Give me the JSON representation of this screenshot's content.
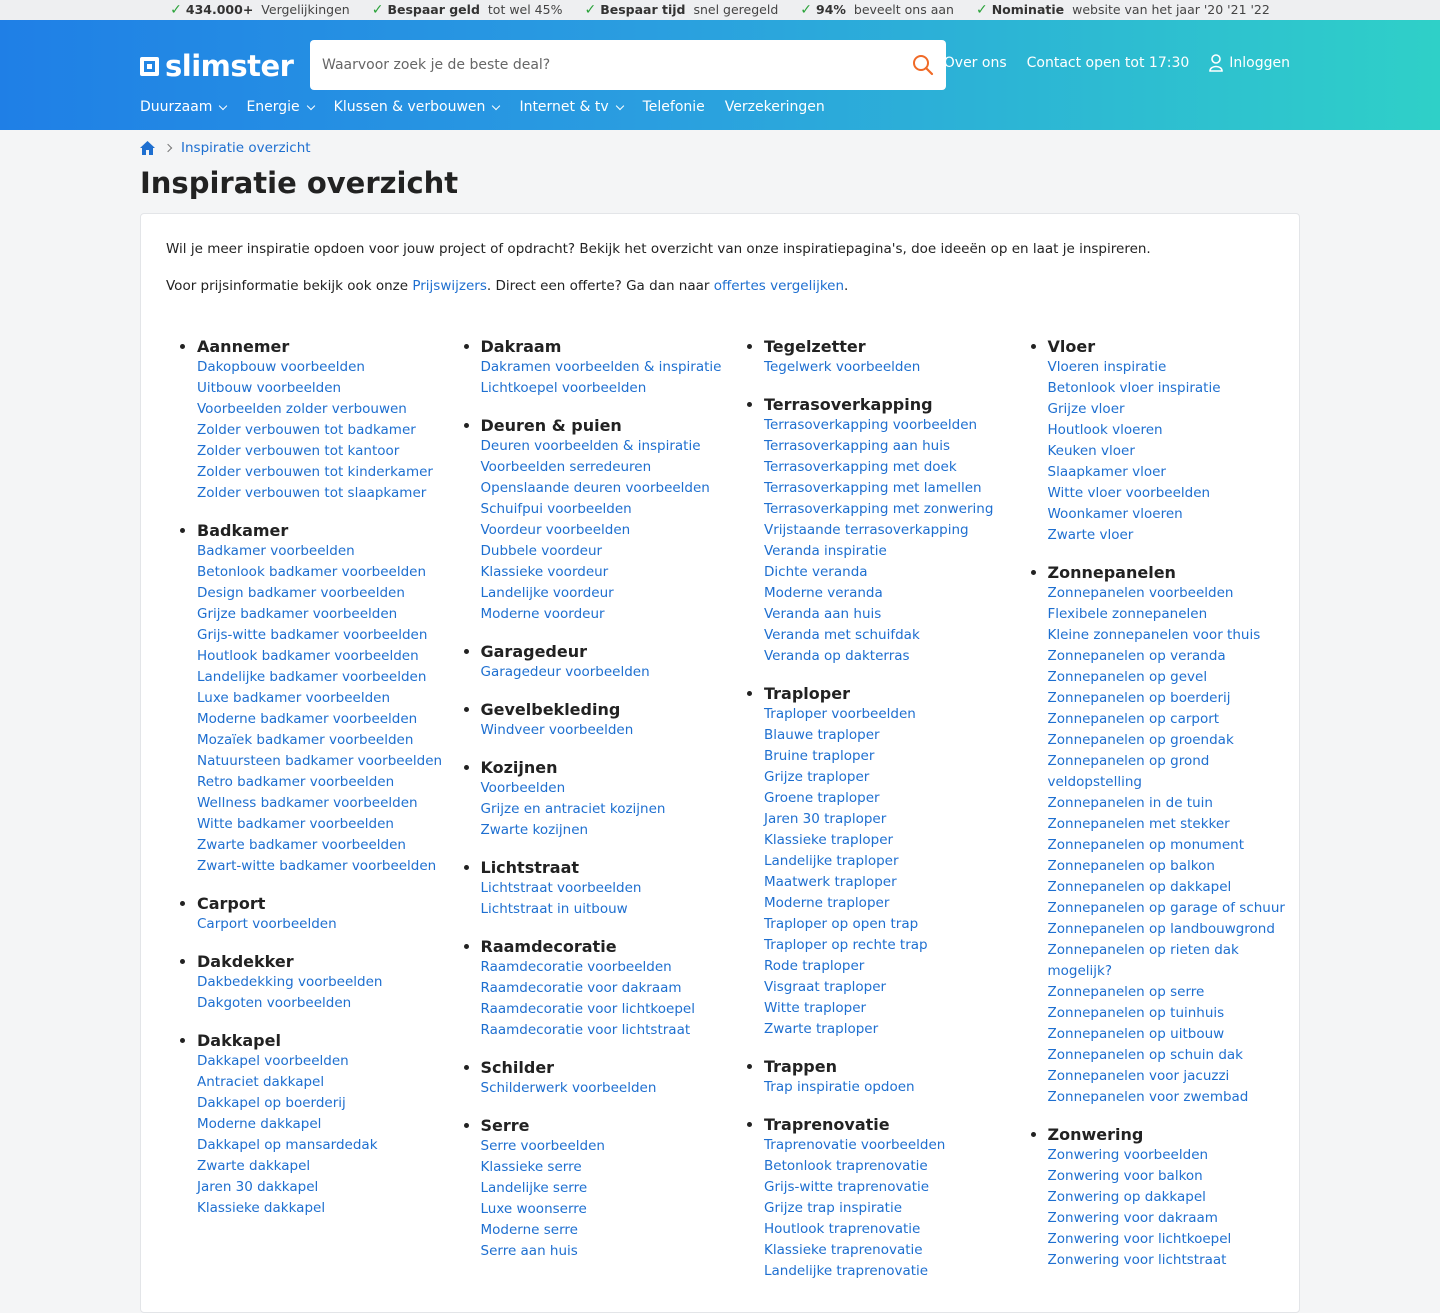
{
  "usp": [
    {
      "bold": "434.000+",
      "text": "Vergelijkingen"
    },
    {
      "bold": "Bespaar geld",
      "text": "tot wel 45%"
    },
    {
      "bold": "Bespaar tijd",
      "text": "snel geregeld"
    },
    {
      "bold": "94%",
      "text": "beveelt ons aan"
    },
    {
      "bold": "Nominatie",
      "text": "website van het jaar '20 '21 '22"
    }
  ],
  "header": {
    "logo": "slimster",
    "search_placeholder": "Waarvoor zoek je de beste deal?",
    "over_ons": "Over ons",
    "contact": "Contact open tot 17:30",
    "login": "Inloggen"
  },
  "nav": [
    {
      "label": "Duurzaam",
      "dropdown": true
    },
    {
      "label": "Energie",
      "dropdown": true
    },
    {
      "label": "Klussen & verbouwen",
      "dropdown": true
    },
    {
      "label": "Internet & tv",
      "dropdown": true
    },
    {
      "label": "Telefonie",
      "dropdown": false
    },
    {
      "label": "Verzekeringen",
      "dropdown": false
    }
  ],
  "breadcrumb": {
    "current": "Inspiratie overzicht"
  },
  "page_title": "Inspiratie overzicht",
  "intro": {
    "p1": "Wil je meer inspiratie opdoen voor jouw project of opdracht? Bekijk het overzicht van onze inspiratiepagina's, doe ideeën op en laat je inspireren.",
    "p2_before": "Voor prijsinformatie bekijk ook onze ",
    "p2_link1": "Prijswijzers",
    "p2_middle": ". Direct een offerte? Ga dan naar ",
    "p2_link2": "offertes vergelijken",
    "p2_after": "."
  },
  "columns": [
    [
      {
        "title": "Aannemer",
        "links": [
          "Dakopbouw voorbeelden",
          "Uitbouw voorbeelden",
          "Voorbeelden zolder verbouwen",
          "Zolder verbouwen tot badkamer",
          "Zolder verbouwen tot kantoor",
          "Zolder verbouwen tot kinderkamer",
          "Zolder verbouwen tot slaapkamer"
        ]
      },
      {
        "title": "Badkamer",
        "links": [
          "Badkamer voorbeelden",
          "Betonlook badkamer voorbeelden",
          "Design badkamer voorbeelden",
          "Grijze badkamer voorbeelden",
          "Grijs-witte badkamer voorbeelden",
          "Houtlook badkamer voorbeelden",
          "Landelijke badkamer voorbeelden",
          "Luxe badkamer voorbeelden",
          "Moderne badkamer voorbeelden",
          "Mozaïek badkamer voorbeelden",
          "Natuursteen badkamer voorbeelden",
          "Retro badkamer voorbeelden",
          "Wellness badkamer voorbeelden",
          "Witte badkamer voorbeelden",
          "Zwarte badkamer voorbeelden",
          "Zwart-witte badkamer voorbeelden"
        ]
      },
      {
        "title": "Carport",
        "links": [
          "Carport voorbeelden"
        ]
      },
      {
        "title": "Dakdekker",
        "links": [
          "Dakbedekking voorbeelden",
          "Dakgoten voorbeelden"
        ]
      },
      {
        "title": "Dakkapel",
        "links": [
          "Dakkapel voorbeelden",
          "Antraciet dakkapel",
          "Dakkapel op boerderij",
          "Moderne dakkapel",
          "Dakkapel op mansardedak",
          "Zwarte dakkapel",
          "Jaren 30 dakkapel",
          "Klassieke dakkapel"
        ]
      }
    ],
    [
      {
        "title": "Dakraam",
        "links": [
          "Dakramen voorbeelden & inspiratie",
          "Lichtkoepel voorbeelden"
        ]
      },
      {
        "title": "Deuren & puien",
        "links": [
          "Deuren voorbeelden & inspiratie",
          "Voorbeelden serredeuren",
          "Openslaande deuren voorbeelden",
          "Schuifpui voorbeelden",
          "Voordeur voorbeelden",
          "Dubbele voordeur",
          "Klassieke voordeur",
          "Landelijke voordeur",
          "Moderne voordeur"
        ]
      },
      {
        "title": "Garagedeur",
        "links": [
          "Garagedeur voorbeelden"
        ]
      },
      {
        "title": "Gevelbekleding",
        "links": [
          "Windveer voorbeelden"
        ]
      },
      {
        "title": "Kozijnen",
        "links": [
          "Voorbeelden",
          "Grijze en antraciet kozijnen",
          "Zwarte kozijnen"
        ]
      },
      {
        "title": "Lichtstraat",
        "links": [
          "Lichtstraat voorbeelden",
          "Lichtstraat in uitbouw"
        ]
      },
      {
        "title": "Raamdecoratie",
        "links": [
          "Raamdecoratie voorbeelden",
          "Raamdecoratie voor dakraam",
          "Raamdecoratie voor lichtkoepel",
          "Raamdecoratie voor lichtstraat"
        ]
      },
      {
        "title": "Schilder",
        "links": [
          "Schilderwerk voorbeelden"
        ]
      },
      {
        "title": "Serre",
        "links": [
          "Serre voorbeelden",
          "Klassieke serre",
          "Landelijke serre",
          "Luxe woonserre",
          "Moderne serre",
          "Serre aan huis"
        ]
      }
    ],
    [
      {
        "title": "Tegelzetter",
        "links": [
          "Tegelwerk voorbeelden"
        ]
      },
      {
        "title": "Terrasoverkapping",
        "links": [
          "Terrasoverkapping voorbeelden",
          "Terrasoverkapping aan huis",
          "Terrasoverkapping met doek",
          "Terrasoverkapping met lamellen",
          "Terrasoverkapping met zonwering",
          "Vrijstaande terrasoverkapping",
          "Veranda inspiratie",
          "Dichte veranda",
          "Moderne veranda",
          "Veranda aan huis",
          "Veranda met schuifdak",
          "Veranda op dakterras"
        ]
      },
      {
        "title": "Traploper",
        "links": [
          "Traploper voorbeelden",
          "Blauwe traploper",
          "Bruine traploper",
          "Grijze traploper",
          "Groene traploper",
          "Jaren 30 traploper",
          "Klassieke traploper",
          "Landelijke traploper",
          "Maatwerk traploper",
          "Moderne traploper",
          "Traploper op open trap",
          "Traploper op rechte trap",
          "Rode traploper",
          "Visgraat traploper",
          "Witte traploper",
          "Zwarte traploper"
        ]
      },
      {
        "title": "Trappen",
        "links": [
          "Trap inspiratie opdoen"
        ]
      },
      {
        "title": "Traprenovatie",
        "links": [
          "Traprenovatie voorbeelden",
          "Betonlook traprenovatie",
          "Grijs-witte traprenovatie",
          "Grijze trap inspiratie",
          "Houtlook traprenovatie",
          "Klassieke traprenovatie",
          "Landelijke traprenovatie"
        ]
      }
    ],
    [
      {
        "title": "Vloer",
        "links": [
          "Vloeren inspiratie",
          "Betonlook vloer inspiratie",
          "Grijze vloer",
          "Houtlook vloeren",
          "Keuken vloer",
          "Slaapkamer vloer",
          "Witte vloer voorbeelden",
          "Woonkamer vloeren",
          "Zwarte vloer"
        ]
      },
      {
        "title": "Zonnepanelen",
        "links": [
          "Zonnepanelen voorbeelden",
          "Flexibele zonnepanelen",
          "Kleine zonnepanelen voor thuis",
          "Zonnepanelen op veranda",
          "Zonnepanelen op gevel",
          "Zonnepanelen op boerderij",
          "Zonnepanelen op carport",
          "Zonnepanelen op groendak",
          "Zonnepanelen op grond veldopstelling",
          "Zonnepanelen in de tuin",
          "Zonnepanelen met stekker",
          "Zonnepanelen op monument",
          "Zonnepanelen op balkon",
          "Zonnepanelen op dakkapel",
          "Zonnepanelen op garage of schuur",
          "Zonnepanelen op landbouwgrond",
          "Zonnepanelen op rieten dak mogelijk?",
          "Zonnepanelen op serre",
          "Zonnepanelen op tuinhuis",
          "Zonnepanelen op uitbouw",
          "Zonnepanelen op schuin dak",
          "Zonnepanelen voor jacuzzi",
          "Zonnepanelen voor zwembad"
        ]
      },
      {
        "title": "Zonwering",
        "links": [
          "Zonwering voorbeelden",
          "Zonwering voor balkon",
          "Zonwering op dakkapel",
          "Zonwering voor dakraam",
          "Zonwering voor lichtkoepel",
          "Zonwering voor lichtstraat"
        ]
      }
    ]
  ]
}
